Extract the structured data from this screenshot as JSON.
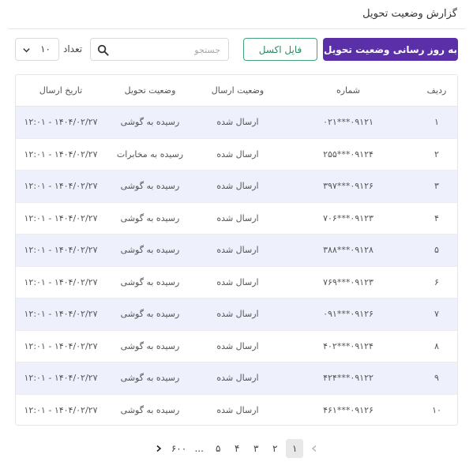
{
  "header": {
    "title": "گزارش وضعیت تحویل"
  },
  "toolbar": {
    "update_label": "به روز رسانی وضعیت تحویل",
    "excel_label": "فایل اکسل",
    "search_placeholder": "جستجو",
    "count_label": "تعداد",
    "count_value": "۱۰"
  },
  "table": {
    "headers": [
      "ردیف",
      "شماره",
      "وضعیت ارسال",
      "وضعیت تحویل",
      "تاریخ ارسال"
    ],
    "rows": [
      [
        "۱",
        "۰۹۱۲۱***۰۲۱",
        "ارسال شده",
        "رسیده به گوشی",
        "۱۴۰۴/۰۲/۲۷ - ۱۲:۰۱"
      ],
      [
        "۲",
        "۰۹۱۲۴***۲۵۵",
        "ارسال شده",
        "رسیده به مخابرات",
        "۱۴۰۴/۰۲/۲۷ - ۱۲:۰۱"
      ],
      [
        "۳",
        "۰۹۱۲۶***۳۹۷",
        "ارسال شده",
        "رسیده به گوشی",
        "۱۴۰۴/۰۲/۲۷ - ۱۲:۰۱"
      ],
      [
        "۴",
        "۰۹۱۲۳***۷۰۶",
        "ارسال شده",
        "رسیده به گوشی",
        "۱۴۰۴/۰۲/۲۷ - ۱۲:۰۱"
      ],
      [
        "۵",
        "۰۹۱۲۸***۳۸۸",
        "ارسال شده",
        "رسیده به گوشی",
        "۱۴۰۴/۰۲/۲۷ - ۱۲:۰۱"
      ],
      [
        "۶",
        "۰۹۱۲۳***۷۶۹",
        "ارسال شده",
        "رسیده به گوشی",
        "۱۴۰۴/۰۲/۲۷ - ۱۲:۰۱"
      ],
      [
        "۷",
        "۰۹۱۲۶***۰۹۱",
        "ارسال شده",
        "رسیده به گوشی",
        "۱۴۰۴/۰۲/۲۷ - ۱۲:۰۱"
      ],
      [
        "۸",
        "۰۹۱۲۴***۴۰۲",
        "ارسال شده",
        "رسیده به گوشی",
        "۱۴۰۴/۰۲/۲۷ - ۱۲:۰۱"
      ],
      [
        "۹",
        "۰۹۱۲۲***۴۲۴",
        "ارسال شده",
        "رسیده به گوشی",
        "۱۴۰۴/۰۲/۲۷ - ۱۲:۰۱"
      ],
      [
        "۱۰",
        "۰۹۱۲۶***۴۶۱",
        "ارسال شده",
        "رسیده به گوشی",
        "۱۴۰۴/۰۲/۲۷ - ۱۲:۰۱"
      ]
    ]
  },
  "pagination": {
    "prev_icon": "chevron-left-icon",
    "next_icon": "chevron-right-icon",
    "pages": [
      "۱",
      "۲",
      "۳",
      "۴",
      "۵"
    ],
    "ellipsis": "...",
    "last_page": "۶۰۰",
    "active_page": "۱"
  },
  "colors": {
    "primary": "#5b2fa8",
    "excel_border": "#43a27a",
    "row_alt": "#eef1fb"
  }
}
